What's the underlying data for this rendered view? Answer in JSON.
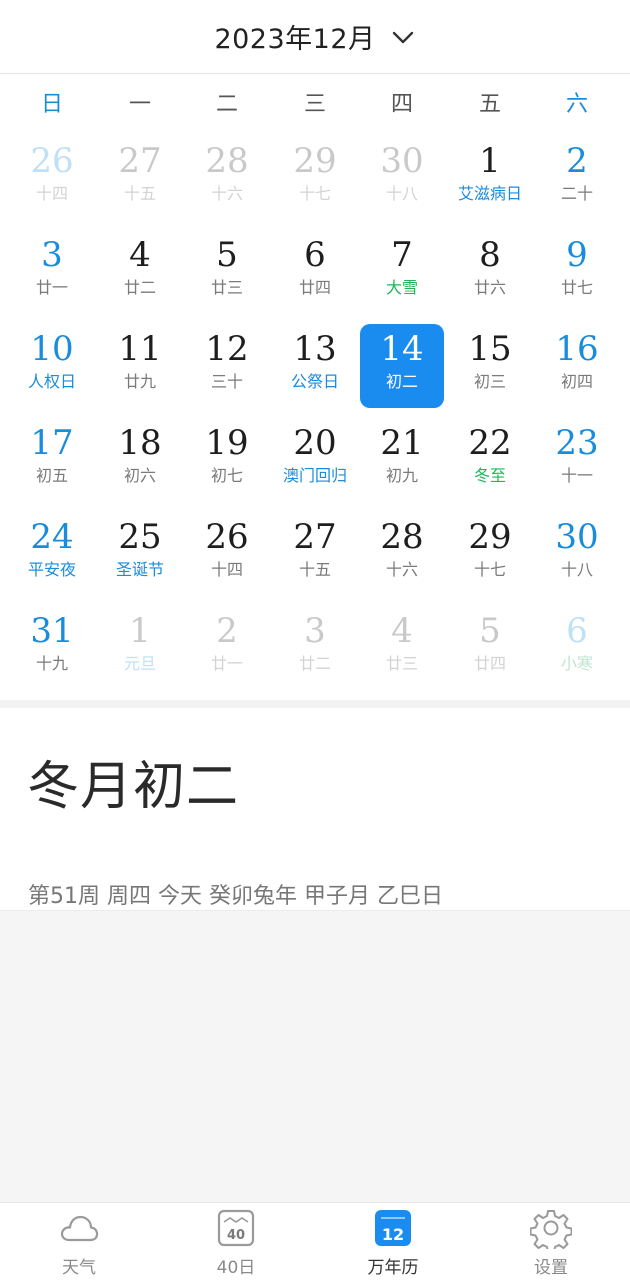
{
  "header": {
    "title": "2023年12月"
  },
  "weekdays": [
    "日",
    "一",
    "二",
    "三",
    "四",
    "五",
    "六"
  ],
  "calendar": {
    "weeks": [
      [
        {
          "day": "26",
          "sub": "十四",
          "other": true
        },
        {
          "day": "27",
          "sub": "十五",
          "other": true
        },
        {
          "day": "28",
          "sub": "十六",
          "other": true
        },
        {
          "day": "29",
          "sub": "十七",
          "other": true
        },
        {
          "day": "30",
          "sub": "十八",
          "other": true
        },
        {
          "day": "1",
          "sub": "艾滋病日",
          "type": "holiday"
        },
        {
          "day": "2",
          "sub": "二十"
        }
      ],
      [
        {
          "day": "3",
          "sub": "廿一"
        },
        {
          "day": "4",
          "sub": "廿二"
        },
        {
          "day": "5",
          "sub": "廿三"
        },
        {
          "day": "6",
          "sub": "廿四"
        },
        {
          "day": "7",
          "sub": "大雪",
          "type": "term"
        },
        {
          "day": "8",
          "sub": "廿六"
        },
        {
          "day": "9",
          "sub": "廿七"
        }
      ],
      [
        {
          "day": "10",
          "sub": "人权日",
          "type": "holiday"
        },
        {
          "day": "11",
          "sub": "廿九"
        },
        {
          "day": "12",
          "sub": "三十"
        },
        {
          "day": "13",
          "sub": "公祭日",
          "type": "holiday"
        },
        {
          "day": "14",
          "sub": "初二",
          "selected": true
        },
        {
          "day": "15",
          "sub": "初三"
        },
        {
          "day": "16",
          "sub": "初四"
        }
      ],
      [
        {
          "day": "17",
          "sub": "初五"
        },
        {
          "day": "18",
          "sub": "初六"
        },
        {
          "day": "19",
          "sub": "初七"
        },
        {
          "day": "20",
          "sub": "澳门回归",
          "type": "holiday"
        },
        {
          "day": "21",
          "sub": "初九"
        },
        {
          "day": "22",
          "sub": "冬至",
          "type": "term"
        },
        {
          "day": "23",
          "sub": "十一"
        }
      ],
      [
        {
          "day": "24",
          "sub": "平安夜",
          "type": "holiday"
        },
        {
          "day": "25",
          "sub": "圣诞节",
          "type": "holiday"
        },
        {
          "day": "26",
          "sub": "十四"
        },
        {
          "day": "27",
          "sub": "十五"
        },
        {
          "day": "28",
          "sub": "十六"
        },
        {
          "day": "29",
          "sub": "十七"
        },
        {
          "day": "30",
          "sub": "十八"
        }
      ],
      [
        {
          "day": "31",
          "sub": "十九"
        },
        {
          "day": "1",
          "sub": "元旦",
          "type": "holiday",
          "other": true
        },
        {
          "day": "2",
          "sub": "廿一",
          "other": true
        },
        {
          "day": "3",
          "sub": "廿二",
          "other": true
        },
        {
          "day": "4",
          "sub": "廿三",
          "other": true
        },
        {
          "day": "5",
          "sub": "廿四",
          "other": true
        },
        {
          "day": "6",
          "sub": "小寒",
          "type": "term",
          "other": true
        }
      ]
    ]
  },
  "info": {
    "lunar_date": "冬月初二",
    "detail": "第51周 周四 今天 癸卯兔年 甲子月 乙巳日"
  },
  "tabs": [
    {
      "label": "天气",
      "icon": "cloud-icon"
    },
    {
      "label": "40日",
      "icon": "calendar-40-icon",
      "icon_text": "40"
    },
    {
      "label": "万年历",
      "icon": "calendar-12-icon",
      "icon_text": "12",
      "active": true
    },
    {
      "label": "设置",
      "icon": "gear-icon"
    }
  ],
  "colors": {
    "accent": "#1a8cf0",
    "weekend": "#1a8cdc",
    "solar_term": "#22b45a"
  }
}
